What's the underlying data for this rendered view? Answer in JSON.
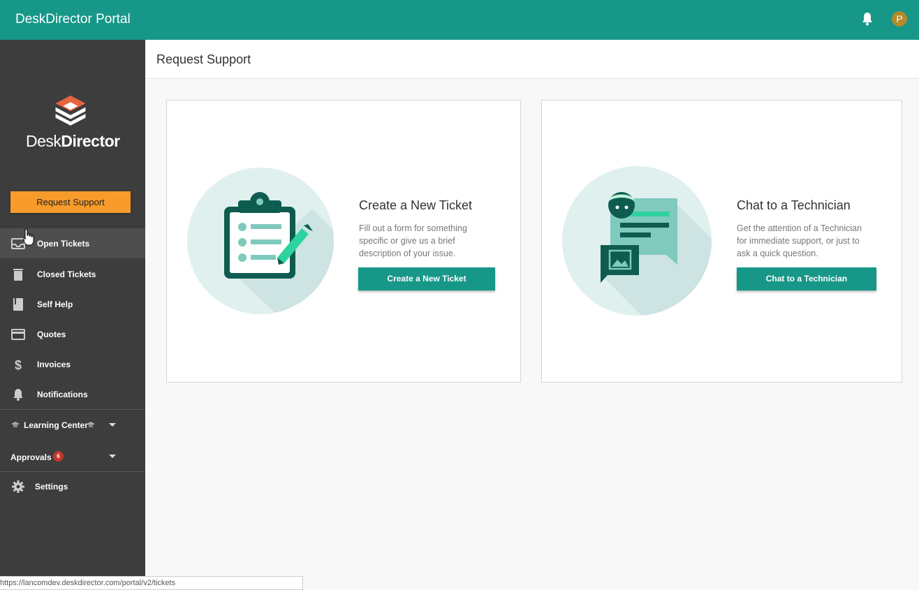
{
  "topbar": {
    "title": "DeskDirector Portal",
    "avatar_initial": "P"
  },
  "sidebar": {
    "logo_text_light": "Desk",
    "logo_text_bold": "Director",
    "request_button": "Request Support",
    "items": [
      {
        "label": "Open Tickets",
        "icon": "inbox-icon"
      },
      {
        "label": "Closed Tickets",
        "icon": "trash-icon"
      },
      {
        "label": "Self Help",
        "icon": "book-icon"
      },
      {
        "label": "Quotes",
        "icon": "card-icon"
      },
      {
        "label": "Invoices",
        "icon": "dollar-icon"
      },
      {
        "label": "Notifications",
        "icon": "bell-icon"
      }
    ],
    "learning_center": "Learning Center",
    "approvals": {
      "label": "Approvals",
      "count": "6"
    },
    "settings": "Settings"
  },
  "page": {
    "title": "Request Support"
  },
  "cards": [
    {
      "title": "Create a New Ticket",
      "desc": "Fill out a form for something specific or give us a brief description of your issue.",
      "button": "Create a New Ticket",
      "icon": "clipboard-icon"
    },
    {
      "title": "Chat to a Technician",
      "desc": "Get the attention of a Technician for immediate support, or just to ask a quick question.",
      "button": "Chat to a Technician",
      "icon": "chat-icon"
    }
  ],
  "status_url": "https://lancomdev.deskdirector.com/portal/v2/tickets",
  "colors": {
    "primary": "#179788",
    "accent": "#f99b2b",
    "sidebar": "#3d3d3d"
  }
}
